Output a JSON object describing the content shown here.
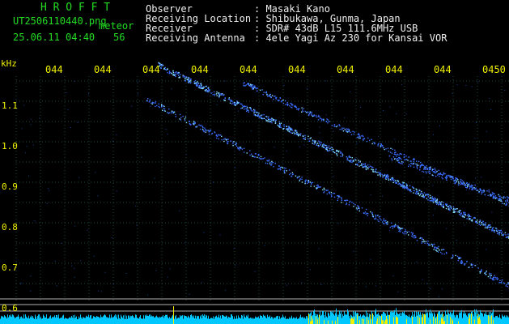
{
  "app": {
    "title": "H R O F F T",
    "filename": "UT2506110440.png",
    "mode": "meteor",
    "date_time": "25.06.11 04:40",
    "count": "56"
  },
  "info": {
    "labels": [
      "Observer",
      "Receiving Location",
      "Receiver",
      "Receiving Antenna"
    ],
    "values": [
      ": Masaki Kano",
      ": Shibukawa, Gunma, Japan",
      ": SDR# 43dB L15 111.6MHz USB",
      ": 4ele Yagi Az 230 for Kansai VOR"
    ]
  },
  "axes": {
    "y_unit": "kHz",
    "y_ticks": [
      "1.1",
      "1.0",
      "0.9",
      "0.8",
      "0.7",
      "0.6"
    ],
    "x_ticks": [
      "044",
      "044",
      "044",
      "044",
      "044",
      "044",
      "044",
      "044",
      "044",
      "0450"
    ]
  },
  "colors": {
    "background": "#000000",
    "grid": "#1d4a3a",
    "signal": "#3a6cff",
    "signal_hot": "#8ce8ff",
    "axis_text": "#f0f000",
    "header_green": "#22dd22",
    "header_white": "#f0f0f0",
    "band_line": "#b0b0b0",
    "bottom_cyan": "#00c8ff",
    "bottom_yellow": "#f0f000"
  }
}
